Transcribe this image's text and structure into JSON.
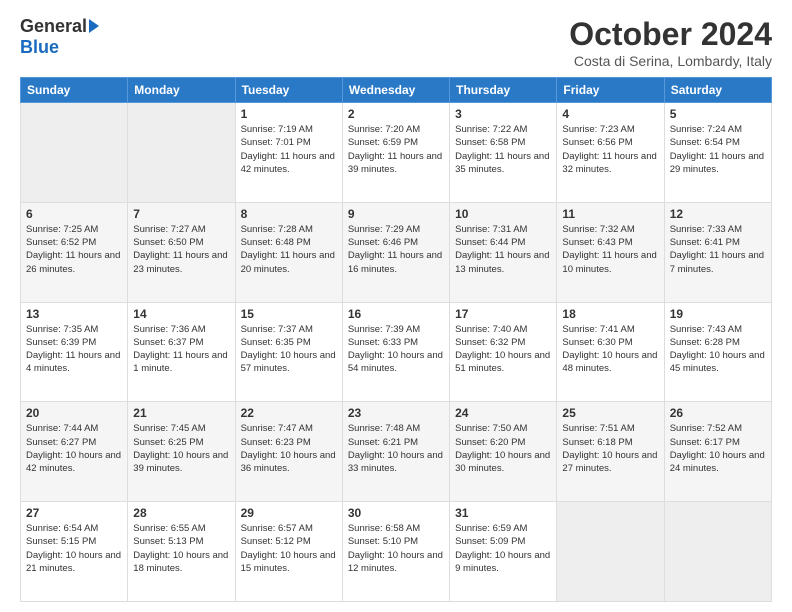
{
  "logo": {
    "general": "General",
    "blue": "Blue"
  },
  "title": "October 2024",
  "location": "Costa di Serina, Lombardy, Italy",
  "headers": [
    "Sunday",
    "Monday",
    "Tuesday",
    "Wednesday",
    "Thursday",
    "Friday",
    "Saturday"
  ],
  "weeks": [
    [
      {
        "day": "",
        "sunrise": "",
        "sunset": "",
        "daylight": ""
      },
      {
        "day": "",
        "sunrise": "",
        "sunset": "",
        "daylight": ""
      },
      {
        "day": "1",
        "sunrise": "Sunrise: 7:19 AM",
        "sunset": "Sunset: 7:01 PM",
        "daylight": "Daylight: 11 hours and 42 minutes."
      },
      {
        "day": "2",
        "sunrise": "Sunrise: 7:20 AM",
        "sunset": "Sunset: 6:59 PM",
        "daylight": "Daylight: 11 hours and 39 minutes."
      },
      {
        "day": "3",
        "sunrise": "Sunrise: 7:22 AM",
        "sunset": "Sunset: 6:58 PM",
        "daylight": "Daylight: 11 hours and 35 minutes."
      },
      {
        "day": "4",
        "sunrise": "Sunrise: 7:23 AM",
        "sunset": "Sunset: 6:56 PM",
        "daylight": "Daylight: 11 hours and 32 minutes."
      },
      {
        "day": "5",
        "sunrise": "Sunrise: 7:24 AM",
        "sunset": "Sunset: 6:54 PM",
        "daylight": "Daylight: 11 hours and 29 minutes."
      }
    ],
    [
      {
        "day": "6",
        "sunrise": "Sunrise: 7:25 AM",
        "sunset": "Sunset: 6:52 PM",
        "daylight": "Daylight: 11 hours and 26 minutes."
      },
      {
        "day": "7",
        "sunrise": "Sunrise: 7:27 AM",
        "sunset": "Sunset: 6:50 PM",
        "daylight": "Daylight: 11 hours and 23 minutes."
      },
      {
        "day": "8",
        "sunrise": "Sunrise: 7:28 AM",
        "sunset": "Sunset: 6:48 PM",
        "daylight": "Daylight: 11 hours and 20 minutes."
      },
      {
        "day": "9",
        "sunrise": "Sunrise: 7:29 AM",
        "sunset": "Sunset: 6:46 PM",
        "daylight": "Daylight: 11 hours and 16 minutes."
      },
      {
        "day": "10",
        "sunrise": "Sunrise: 7:31 AM",
        "sunset": "Sunset: 6:44 PM",
        "daylight": "Daylight: 11 hours and 13 minutes."
      },
      {
        "day": "11",
        "sunrise": "Sunrise: 7:32 AM",
        "sunset": "Sunset: 6:43 PM",
        "daylight": "Daylight: 11 hours and 10 minutes."
      },
      {
        "day": "12",
        "sunrise": "Sunrise: 7:33 AM",
        "sunset": "Sunset: 6:41 PM",
        "daylight": "Daylight: 11 hours and 7 minutes."
      }
    ],
    [
      {
        "day": "13",
        "sunrise": "Sunrise: 7:35 AM",
        "sunset": "Sunset: 6:39 PM",
        "daylight": "Daylight: 11 hours and 4 minutes."
      },
      {
        "day": "14",
        "sunrise": "Sunrise: 7:36 AM",
        "sunset": "Sunset: 6:37 PM",
        "daylight": "Daylight: 11 hours and 1 minute."
      },
      {
        "day": "15",
        "sunrise": "Sunrise: 7:37 AM",
        "sunset": "Sunset: 6:35 PM",
        "daylight": "Daylight: 10 hours and 57 minutes."
      },
      {
        "day": "16",
        "sunrise": "Sunrise: 7:39 AM",
        "sunset": "Sunset: 6:33 PM",
        "daylight": "Daylight: 10 hours and 54 minutes."
      },
      {
        "day": "17",
        "sunrise": "Sunrise: 7:40 AM",
        "sunset": "Sunset: 6:32 PM",
        "daylight": "Daylight: 10 hours and 51 minutes."
      },
      {
        "day": "18",
        "sunrise": "Sunrise: 7:41 AM",
        "sunset": "Sunset: 6:30 PM",
        "daylight": "Daylight: 10 hours and 48 minutes."
      },
      {
        "day": "19",
        "sunrise": "Sunrise: 7:43 AM",
        "sunset": "Sunset: 6:28 PM",
        "daylight": "Daylight: 10 hours and 45 minutes."
      }
    ],
    [
      {
        "day": "20",
        "sunrise": "Sunrise: 7:44 AM",
        "sunset": "Sunset: 6:27 PM",
        "daylight": "Daylight: 10 hours and 42 minutes."
      },
      {
        "day": "21",
        "sunrise": "Sunrise: 7:45 AM",
        "sunset": "Sunset: 6:25 PM",
        "daylight": "Daylight: 10 hours and 39 minutes."
      },
      {
        "day": "22",
        "sunrise": "Sunrise: 7:47 AM",
        "sunset": "Sunset: 6:23 PM",
        "daylight": "Daylight: 10 hours and 36 minutes."
      },
      {
        "day": "23",
        "sunrise": "Sunrise: 7:48 AM",
        "sunset": "Sunset: 6:21 PM",
        "daylight": "Daylight: 10 hours and 33 minutes."
      },
      {
        "day": "24",
        "sunrise": "Sunrise: 7:50 AM",
        "sunset": "Sunset: 6:20 PM",
        "daylight": "Daylight: 10 hours and 30 minutes."
      },
      {
        "day": "25",
        "sunrise": "Sunrise: 7:51 AM",
        "sunset": "Sunset: 6:18 PM",
        "daylight": "Daylight: 10 hours and 27 minutes."
      },
      {
        "day": "26",
        "sunrise": "Sunrise: 7:52 AM",
        "sunset": "Sunset: 6:17 PM",
        "daylight": "Daylight: 10 hours and 24 minutes."
      }
    ],
    [
      {
        "day": "27",
        "sunrise": "Sunrise: 6:54 AM",
        "sunset": "Sunset: 5:15 PM",
        "daylight": "Daylight: 10 hours and 21 minutes."
      },
      {
        "day": "28",
        "sunrise": "Sunrise: 6:55 AM",
        "sunset": "Sunset: 5:13 PM",
        "daylight": "Daylight: 10 hours and 18 minutes."
      },
      {
        "day": "29",
        "sunrise": "Sunrise: 6:57 AM",
        "sunset": "Sunset: 5:12 PM",
        "daylight": "Daylight: 10 hours and 15 minutes."
      },
      {
        "day": "30",
        "sunrise": "Sunrise: 6:58 AM",
        "sunset": "Sunset: 5:10 PM",
        "daylight": "Daylight: 10 hours and 12 minutes."
      },
      {
        "day": "31",
        "sunrise": "Sunrise: 6:59 AM",
        "sunset": "Sunset: 5:09 PM",
        "daylight": "Daylight: 10 hours and 9 minutes."
      },
      {
        "day": "",
        "sunrise": "",
        "sunset": "",
        "daylight": ""
      },
      {
        "day": "",
        "sunrise": "",
        "sunset": "",
        "daylight": ""
      }
    ]
  ]
}
